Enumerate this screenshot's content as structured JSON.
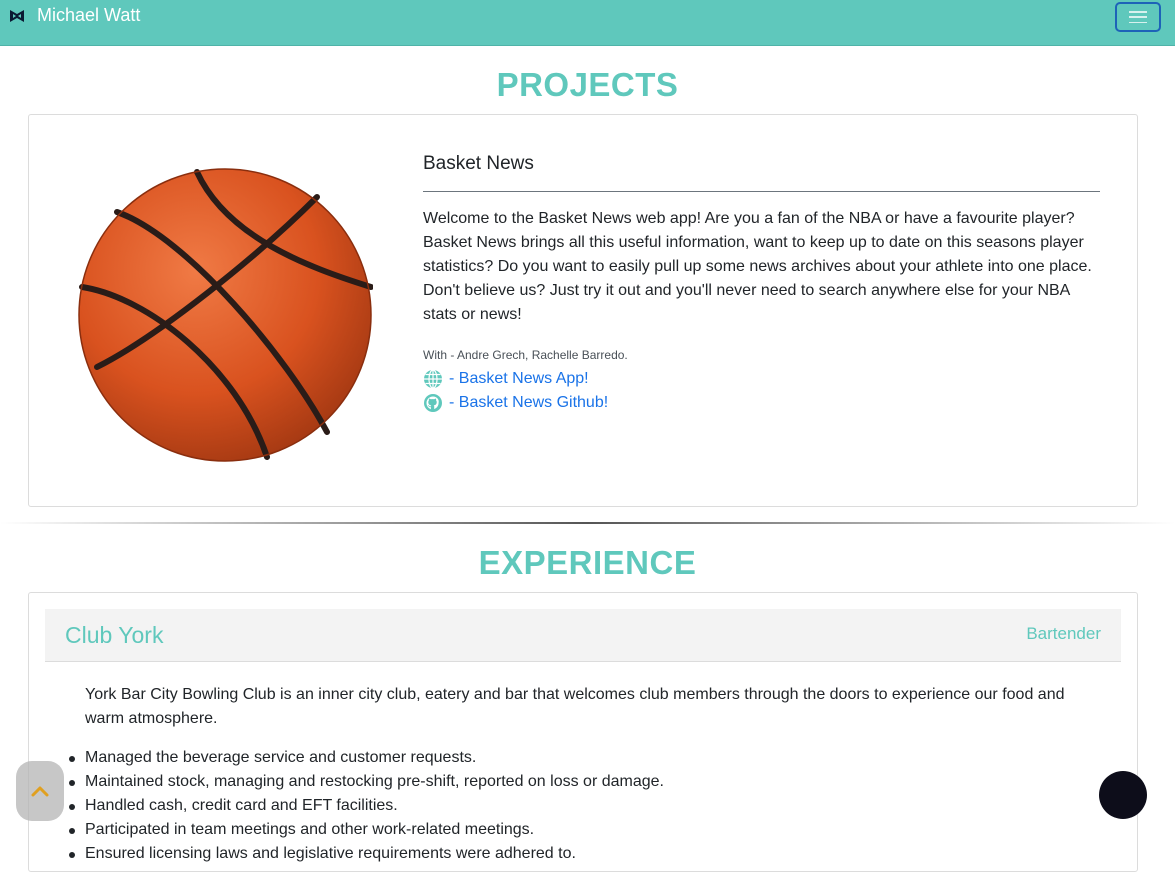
{
  "navbar": {
    "brand_name": "Michael Watt",
    "logo_icon": "bowtie-logo-icon",
    "toggle_icon": "hamburger-menu-icon",
    "bg_color": "#5fc8bc"
  },
  "projects": {
    "heading": "PROJECTS",
    "items": [
      {
        "image": "basketball-image",
        "title": "Basket News",
        "description": "Welcome to the Basket News web app! Are you a fan of the NBA or have a favourite player? Basket News brings all this useful information, want to keep up to date on this seasons player statistics? Do you want to easily pull up some news archives about your athlete into one place. Don't believe us? Just try it out and you'll never need to search anywhere else for your NBA stats or news!",
        "collaborators": "With - Andre Grech, Rachelle Barredo.",
        "links": [
          {
            "icon": "globe-icon",
            "label": "- Basket News App!"
          },
          {
            "icon": "github-icon",
            "label": "- Basket News Github!"
          }
        ]
      }
    ]
  },
  "experience": {
    "heading": "EXPERIENCE",
    "items": [
      {
        "company": "Club York",
        "role": "Bartender",
        "description": "York Bar City Bowling Club is an inner city club, eatery and bar that welcomes club members through the doors to experience our food and warm atmosphere.",
        "duties": [
          "Managed the beverage service and customer requests.",
          "Maintained stock, managing and restocking pre-shift, reported on loss or damage.",
          "Handled cash, credit card and EFT facilities.",
          "Participated in team meetings and other work-related meetings.",
          "Ensured licensing laws and legislative requirements were adhered to."
        ]
      }
    ]
  },
  "floating": {
    "scroll_top_icon": "chevron-up-icon",
    "chat_icon": "chat-bubble-icon"
  },
  "colors": {
    "accent": "#5fc8bc",
    "link": "#1a73e8",
    "scroll_arrow": "#e0a020"
  }
}
